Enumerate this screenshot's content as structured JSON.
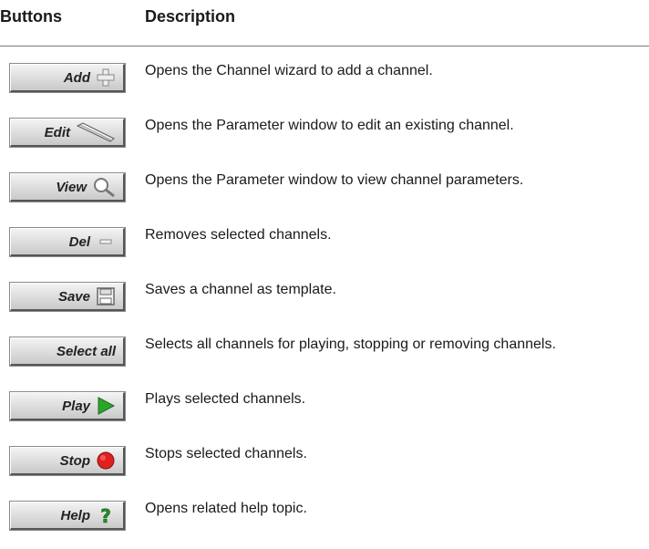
{
  "header": {
    "buttons": "Buttons",
    "description": "Description"
  },
  "rows": [
    {
      "button": "Add",
      "icon": "plus-icon",
      "description": "Opens the Channel wizard to add a channel."
    },
    {
      "button": "Edit",
      "icon": "pencil-icon",
      "description": "Opens the Parameter window to edit an existing channel."
    },
    {
      "button": "View",
      "icon": "magnifier-icon",
      "description": "Opens the Parameter window to view channel parameters."
    },
    {
      "button": "Del",
      "icon": "minus-icon",
      "description": "Removes selected channels."
    },
    {
      "button": "Save",
      "icon": "floppy-disk-icon",
      "description": "Saves a channel as template."
    },
    {
      "button": "Select all",
      "icon": "",
      "description": "Selects all channels for playing, stopping or removing channels."
    },
    {
      "button": "Play",
      "icon": "play-triangle-icon",
      "description": "Plays selected channels."
    },
    {
      "button": "Stop",
      "icon": "stop-circle-icon",
      "description": "Stops selected channels."
    },
    {
      "button": "Help",
      "icon": "question-mark-icon",
      "description": "Opens related help topic."
    }
  ],
  "colors": {
    "play_icon": "#2aa52a",
    "stop_icon": "#e02020",
    "help_icon": "#1f8f2a",
    "add_icon": "#eeeeee"
  }
}
